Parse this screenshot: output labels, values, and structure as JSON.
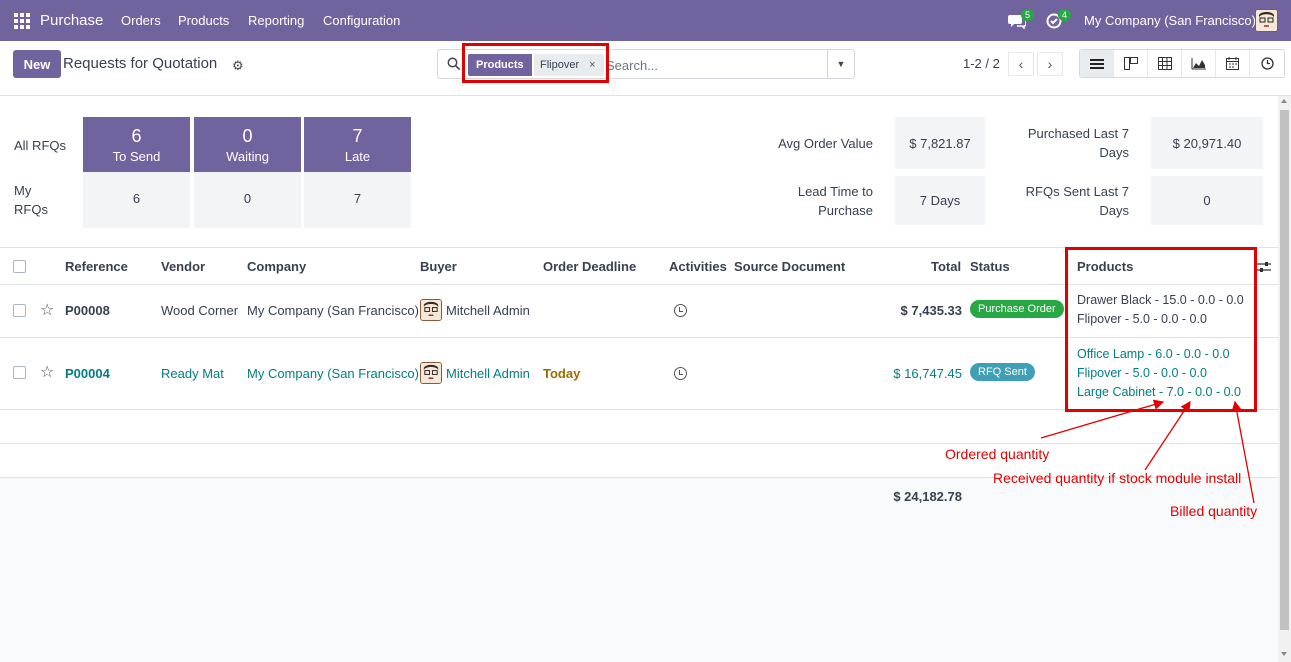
{
  "navbar": {
    "brand": "Purchase",
    "menu": [
      "Orders",
      "Products",
      "Reporting",
      "Configuration"
    ],
    "messages_count": "5",
    "activities_count": "4",
    "company": "My Company (San Francisco)"
  },
  "control": {
    "new_label": "New",
    "title": "Requests for Quotation",
    "facet_category": "Products",
    "facet_value": "Flipover",
    "search_placeholder": "Search...",
    "pager": "1-2 / 2"
  },
  "dashboard": {
    "all_rfqs_label": "All RFQs",
    "my_rfqs_label_1": "My",
    "my_rfqs_label_2": "RFQs",
    "tiles": [
      {
        "all": "6",
        "label": "To Send",
        "my": "6"
      },
      {
        "all": "0",
        "label": "Waiting",
        "my": "0"
      },
      {
        "all": "7",
        "label": "Late",
        "my": "7"
      }
    ],
    "avg_order_label": "Avg Order Value",
    "avg_order_value": "$ 7,821.87",
    "lead_time_label_1": "Lead Time to",
    "lead_time_label_2": "Purchase",
    "lead_time_value": "7 Days",
    "purchased_label_1": "Purchased Last 7",
    "purchased_label_2": "Days",
    "purchased_value": "$ 20,971.40",
    "rfqs_sent_label_1": "RFQs Sent Last 7",
    "rfqs_sent_label_2": "Days",
    "rfqs_sent_value": "0"
  },
  "table": {
    "headers": {
      "reference": "Reference",
      "vendor": "Vendor",
      "company": "Company",
      "buyer": "Buyer",
      "deadline": "Order Deadline",
      "activities": "Activities",
      "source": "Source Document",
      "total": "Total",
      "status": "Status",
      "products": "Products"
    },
    "rows": [
      {
        "reference": "P00008",
        "vendor": "Wood Corner",
        "company": "My Company (San Francisco)",
        "buyer": "Mitchell Admin",
        "deadline": "",
        "total": "$ 7,435.33",
        "status": "Purchase Order",
        "status_color": "#28a745",
        "products": [
          "Drawer Black - 15.0 - 0.0 - 0.0",
          "Flipover - 5.0 - 0.0 - 0.0"
        ]
      },
      {
        "reference": "P00004",
        "vendor": "Ready Mat",
        "company": "My Company (San Francisco)",
        "buyer": "Mitchell Admin",
        "deadline": "Today",
        "total": "$ 16,747.45",
        "status": "RFQ Sent",
        "status_color": "#3fa0b5",
        "products": [
          "Office Lamp - 6.0 - 0.0 - 0.0",
          "Flipover - 5.0 - 0.0 - 0.0",
          "Large Cabinet - 7.0 - 0.0 - 0.0"
        ]
      }
    ],
    "grand_total": "$ 24,182.78"
  },
  "annotations": {
    "ordered": "Ordered quantity",
    "received": "Received quantity if stock module install",
    "billed": "Billed quantity"
  },
  "colors": {
    "brand": "#71639e",
    "link": "#017e84",
    "annotation": "#e30000"
  }
}
